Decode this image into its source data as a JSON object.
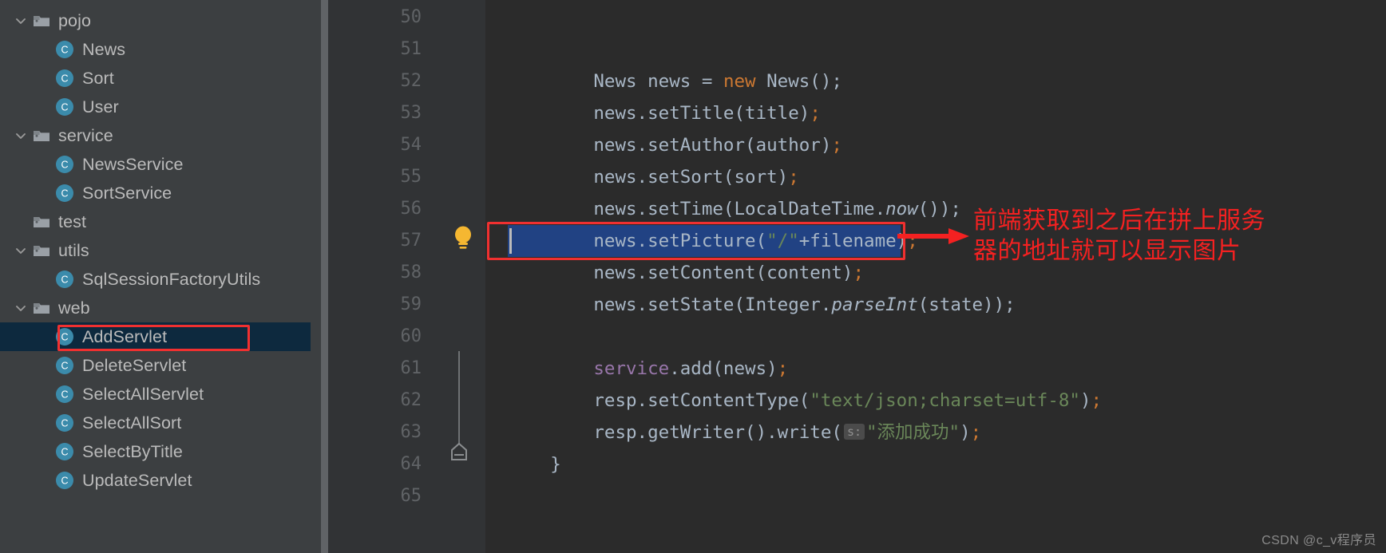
{
  "sidebar": {
    "tree": [
      {
        "label": "pojo",
        "kind": "folder",
        "indent": 0,
        "expanded": true,
        "selected": false
      },
      {
        "label": "News",
        "kind": "class",
        "indent": 1,
        "expanded": null,
        "selected": false
      },
      {
        "label": "Sort",
        "kind": "class",
        "indent": 1,
        "expanded": null,
        "selected": false
      },
      {
        "label": "User",
        "kind": "class",
        "indent": 1,
        "expanded": null,
        "selected": false
      },
      {
        "label": "service",
        "kind": "folder",
        "indent": 0,
        "expanded": true,
        "selected": false
      },
      {
        "label": "NewsService",
        "kind": "class",
        "indent": 1,
        "expanded": null,
        "selected": false
      },
      {
        "label": "SortService",
        "kind": "class",
        "indent": 1,
        "expanded": null,
        "selected": false
      },
      {
        "label": "test",
        "kind": "folder",
        "indent": 0,
        "expanded": false,
        "selected": false
      },
      {
        "label": "utils",
        "kind": "folder",
        "indent": 0,
        "expanded": true,
        "selected": false
      },
      {
        "label": "SqlSessionFactoryUtils",
        "kind": "class",
        "indent": 1,
        "expanded": null,
        "selected": false
      },
      {
        "label": "web",
        "kind": "folder",
        "indent": 0,
        "expanded": true,
        "selected": false
      },
      {
        "label": "AddServlet",
        "kind": "class",
        "indent": 1,
        "expanded": null,
        "selected": true
      },
      {
        "label": "DeleteServlet",
        "kind": "class",
        "indent": 1,
        "expanded": null,
        "selected": false
      },
      {
        "label": "SelectAllServlet",
        "kind": "class",
        "indent": 1,
        "expanded": null,
        "selected": false
      },
      {
        "label": "SelectAllSort",
        "kind": "class",
        "indent": 1,
        "expanded": null,
        "selected": false
      },
      {
        "label": "SelectByTitle",
        "kind": "class",
        "indent": 1,
        "expanded": null,
        "selected": false
      },
      {
        "label": "UpdateServlet",
        "kind": "class",
        "indent": 1,
        "expanded": null,
        "selected": false
      }
    ],
    "class_icon_letter": "C"
  },
  "editor": {
    "line_numbers": [
      "50",
      "51",
      "52",
      "53",
      "54",
      "55",
      "56",
      "57",
      "58",
      "59",
      "60",
      "61",
      "62",
      "63",
      "64",
      "65"
    ],
    "first_line_number": 50,
    "selected_line_number": "57",
    "gutter_bulb_icon": "lightbulb-intention-icon",
    "fold_marker_icon": "code-fold-end-icon",
    "param_hint_label": "s:",
    "lines": {
      "l50": "",
      "l51": "",
      "l52": "        News news = new News();",
      "l53": "        news.setTitle(title);",
      "l54": "        news.setAuthor(author);",
      "l55": "        news.setSort(sort);",
      "l56": "        news.setTime(LocalDateTime.now());",
      "l57": "        news.setPicture(\"/\"+filename);",
      "l58": "        news.setContent(content);",
      "l59": "        news.setState(Integer.parseInt(state));",
      "l60": "",
      "l61": "        service.add(news);",
      "l62": "        resp.setContentType(\"text/json;charset=utf-8\");",
      "l63": "        resp.getWriter().write( s: \"添加成功\");",
      "l64": "    }",
      "l65": ""
    },
    "tokens": {
      "news_type": "News",
      "news_var": " news ",
      "equals": "= ",
      "kw_new": "new",
      "news_ctor": " News();",
      "set_title": "news.setTitle(title)",
      "set_author": "news.setAuthor(author)",
      "set_sort": "news.setSort(sort)",
      "set_time_pre": "news.setTime(LocalDateTime.",
      "set_time_now": "now",
      "set_time_post": "());",
      "set_picture_pre": "news.setPicture(",
      "set_picture_str": "\"/\"",
      "set_picture_mid": "+filename)",
      "set_content": "news.setContent(content)",
      "set_state_pre": "news.setState(Integer.",
      "set_state_m": "parseInt",
      "set_state_post": "(state));",
      "service_field": "service",
      "service_call": ".add(news)",
      "resp_ct_pre": "resp.setContentType(",
      "resp_ct_str": "\"text/json;charset=utf-8\"",
      "resp_ct_post": ")",
      "resp_w_pre": "resp.getWriter().write(",
      "resp_w_str": "\"添加成功\"",
      "resp_w_post": ")",
      "semicolon": ";",
      "close_brace": "}"
    }
  },
  "annotation": {
    "text": "前端获取到之后在拼上服务器的地址就可以显示图片",
    "color": "#f42121",
    "arrow_icon": "right-arrow-icon",
    "box_label_line": "57",
    "box_label_tree": "AddServlet"
  },
  "watermark": {
    "text": "CSDN @c_v程序员"
  },
  "colors": {
    "sidebar_bg": "#3c3f41",
    "editor_bg": "#2b2b2b",
    "gutter_bg": "#313335",
    "selection_bg": "#214283",
    "tree_selection_bg": "#0d293e",
    "annotation_red": "#f42121",
    "keyword_orange": "#cc7832",
    "string_green": "#6a8759",
    "field_purple": "#9876aa",
    "text_gray": "#a9b7c6",
    "class_icon_teal": "#3b8bab",
    "bulb_yellow": "#f5b731"
  }
}
